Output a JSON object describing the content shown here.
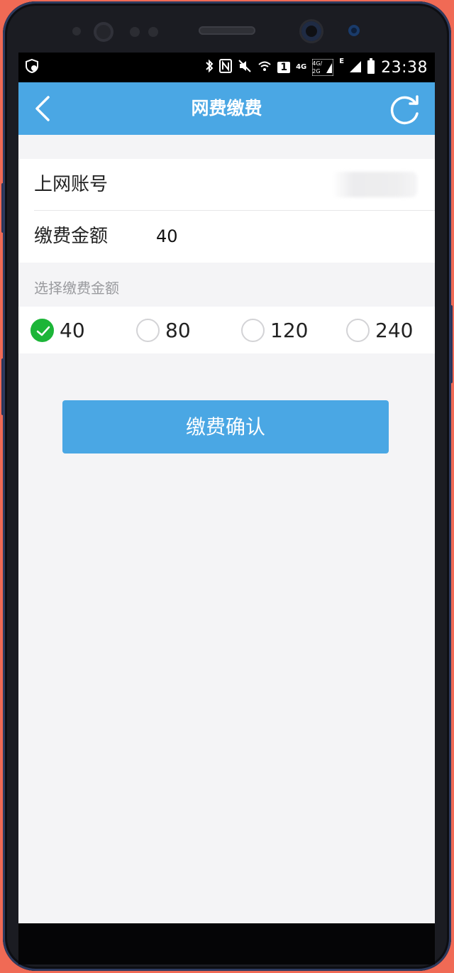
{
  "status_bar": {
    "time": "23:38",
    "icons": [
      "shield-icon",
      "bluetooth-icon",
      "nfc-icon",
      "mute-icon",
      "wifi-icon",
      "sim-1-icon",
      "signal-4g-icon",
      "signal-e-icon",
      "battery-icon"
    ],
    "sim_slot": "1",
    "net_4g": "4G",
    "net_4g2g": "4G/2G",
    "net_e": "E"
  },
  "header": {
    "title": "网费缴费",
    "back_icon": "chevron-left-icon",
    "refresh_icon": "refresh-icon"
  },
  "form": {
    "account_label": "上网账号",
    "amount_label": "缴费金额",
    "amount_value": "40"
  },
  "options": {
    "section_label": "选择缴费金额",
    "items": [
      {
        "label": "40",
        "selected": true
      },
      {
        "label": "80",
        "selected": false
      },
      {
        "label": "120",
        "selected": false
      },
      {
        "label": "240",
        "selected": false
      }
    ]
  },
  "confirm_button": {
    "label": "缴费确认"
  },
  "colors": {
    "accent": "#4aa7e4",
    "selected": "#1cb538",
    "background": "#f4f4f6",
    "frame_backdrop": "#f06a55"
  }
}
